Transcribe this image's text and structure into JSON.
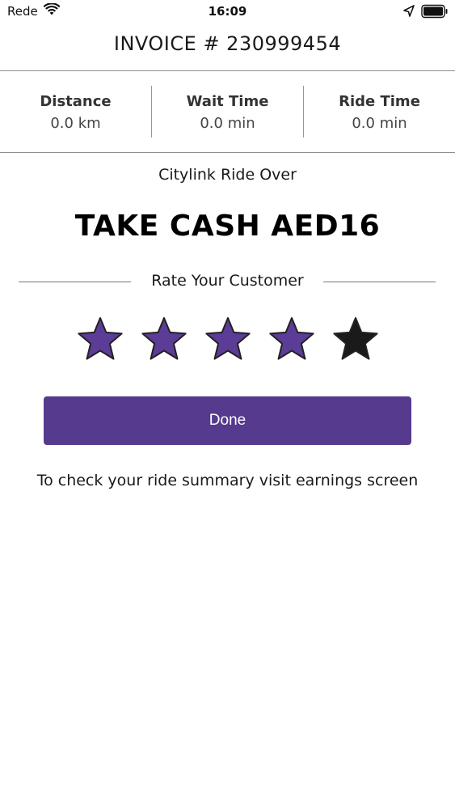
{
  "status_bar": {
    "carrier": "Rede",
    "time": "16:09",
    "icons": [
      "wifi-icon",
      "location-arrow-icon",
      "battery-icon"
    ]
  },
  "header": {
    "invoice_title": "INVOICE # 230999454"
  },
  "stats": [
    {
      "label": "Distance",
      "value": "0.0 km"
    },
    {
      "label": "Wait Time",
      "value": "0.0 min"
    },
    {
      "label": "Ride Time",
      "value": "0.0 min"
    }
  ],
  "ride_status": "Citylink Ride Over",
  "cash_prompt": "TAKE CASH AED16",
  "rating": {
    "label": "Rate Your Customer",
    "selected": 4,
    "max": 5,
    "filled_color": "#5b3c96",
    "empty_color": "#1a1a1a"
  },
  "done_button": {
    "label": "Done",
    "color": "#553a8d"
  },
  "summary_note": "To check your ride summary visit earnings screen"
}
